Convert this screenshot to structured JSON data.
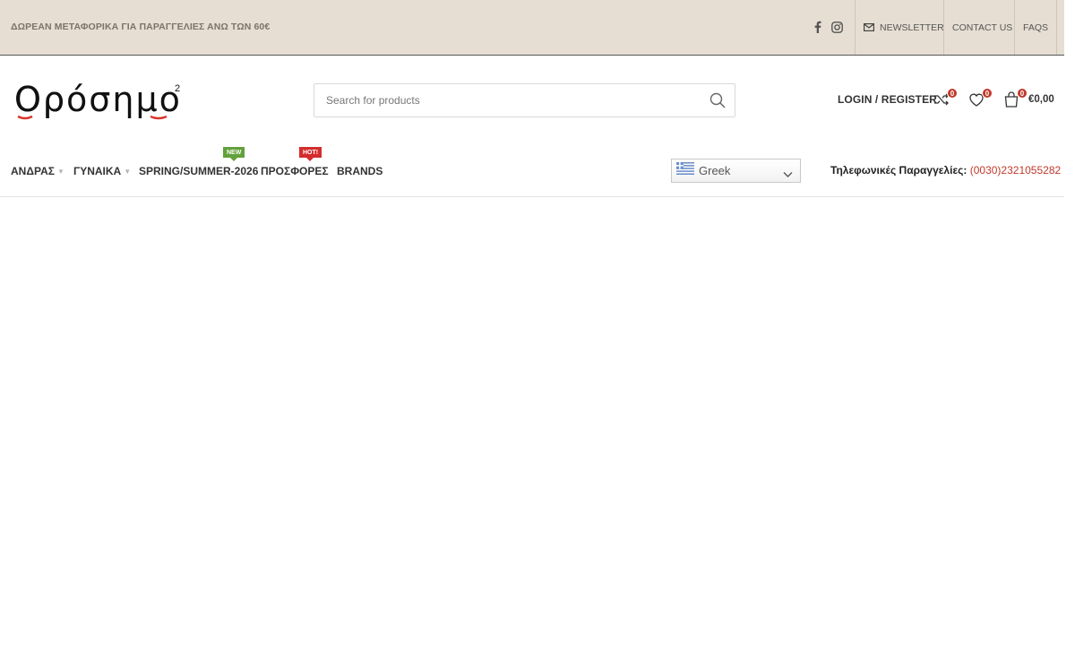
{
  "topbar": {
    "promo": "ΔΩΡΕΑΝ ΜΕΤΑΦΟΡΙΚΑ ΓΙΑ ΠΑΡΑΓΓΕΛΙΕΣ ΑΝΩ ΤΩΝ 60€",
    "social": [
      "facebook-icon",
      "instagram-icon"
    ],
    "links": {
      "newsletter": "NEWSLETTER",
      "contact": "CONTACT US",
      "faqs": "FAQS"
    }
  },
  "logo": {
    "text": "Ορόσημο",
    "superscript": "2"
  },
  "search": {
    "placeholder": "Search for products"
  },
  "header": {
    "login": "LOGIN / REGISTER",
    "compare_count": "0",
    "wishlist_count": "0",
    "cart_count": "0",
    "cart_total": "€0,00"
  },
  "nav": {
    "items": [
      {
        "label": "ΑΝΔΡΑΣ",
        "has_dropdown": true
      },
      {
        "label": "ΓΥΝΑΙΚΑ",
        "has_dropdown": true
      },
      {
        "label": "SPRING/SUMMER-2026",
        "tag": "NEW"
      },
      {
        "label": "ΠΡΟΣΦΟΡΕΣ",
        "tag": "HOT!"
      },
      {
        "label": "BRANDS"
      }
    ]
  },
  "language": {
    "selected": "Greek"
  },
  "phone": {
    "label": "Τηλεφωνικές Παραγγελίες",
    "separator": ":",
    "number": "(0030)2321055282"
  },
  "colors": {
    "topbar_bg": "#e6ded2",
    "accent_red": "#c0392b",
    "tag_new": "#62a13b",
    "tag_hot": "#d32d2d"
  }
}
